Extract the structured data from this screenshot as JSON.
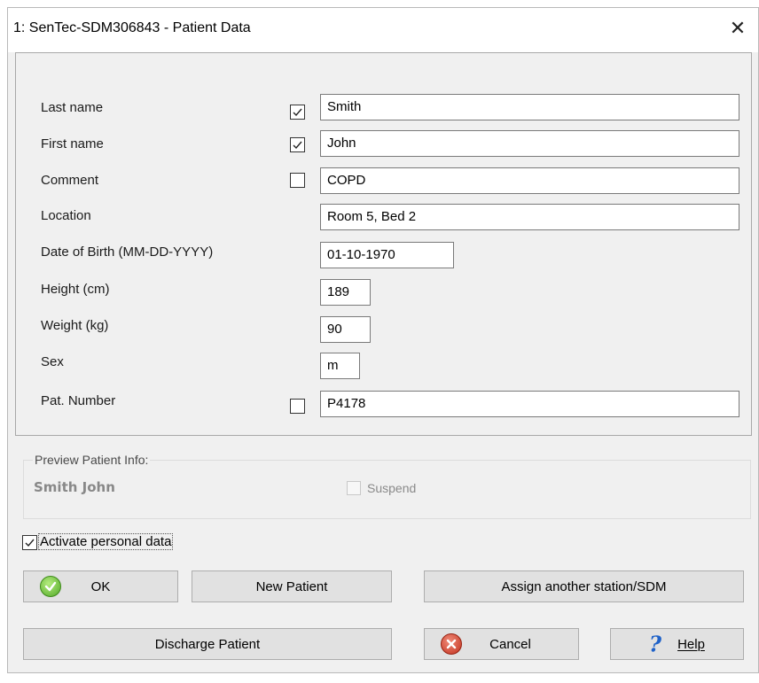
{
  "window": {
    "title": "1: SenTec-SDM306843 - Patient Data",
    "close_symbol": "✕"
  },
  "form": {
    "last_name": {
      "label": "Last name",
      "checked": true,
      "value": "Smith"
    },
    "first_name": {
      "label": "First name",
      "checked": true,
      "value": "John"
    },
    "comment": {
      "label": "Comment",
      "checked": false,
      "value": "COPD"
    },
    "location": {
      "label": "Location",
      "value": "Room 5, Bed 2"
    },
    "dob": {
      "label": "Date of Birth (MM-DD-YYYY)",
      "value": "01-10-1970"
    },
    "height": {
      "label": "Height (cm)",
      "value": "189"
    },
    "weight": {
      "label": "Weight (kg)",
      "value": "90"
    },
    "sex": {
      "label": "Sex",
      "value": "m"
    },
    "pat_number": {
      "label": "Pat. Number",
      "checked": false,
      "value": "P4178"
    }
  },
  "preview": {
    "legend": "Preview Patient Info:",
    "name": "Smith John",
    "suspend_label": "Suspend",
    "suspend_checked": false
  },
  "activate": {
    "label": "Activate personal data",
    "checked": true
  },
  "buttons": {
    "ok": "OK",
    "new_patient": "New Patient",
    "assign": "Assign another station/SDM",
    "discharge": "Discharge Patient",
    "cancel": "Cancel",
    "help": "Help"
  },
  "icons": {
    "ok": "check-circle-green",
    "cancel": "x-circle-red",
    "help": "question-mark-blue"
  },
  "colors": {
    "ok_green": "#52a927",
    "cancel_red": "#c2321f",
    "help_blue": "#1f62c9",
    "dialog_bg": "#f0f0f0"
  }
}
